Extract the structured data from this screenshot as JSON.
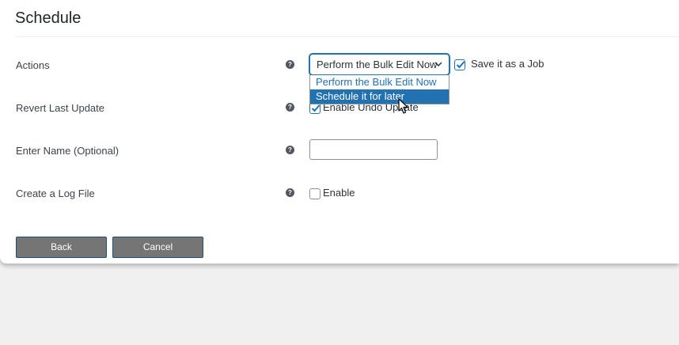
{
  "section": {
    "title": "Schedule"
  },
  "rows": {
    "actions": {
      "label": "Actions",
      "select_value": "Perform the Bulk Edit Now",
      "options": [
        "Perform the Bulk Edit Now",
        "Schedule it for later"
      ],
      "highlighted_option": "Schedule it for later",
      "save_job_label": "Save it as a Job",
      "save_job_checked": true
    },
    "revert": {
      "label": "Revert Last Update",
      "checkbox_label": "Enable Undo Update",
      "checked": true
    },
    "name": {
      "label": "Enter Name (Optional)",
      "value": ""
    },
    "log": {
      "label": "Create a Log File",
      "checkbox_label": "Enable",
      "checked": false
    }
  },
  "help_icon_glyph": "?",
  "buttons": {
    "back": "Back",
    "cancel": "Cancel"
  },
  "colors": {
    "accent": "#2271b1",
    "button_bg": "#757575"
  }
}
